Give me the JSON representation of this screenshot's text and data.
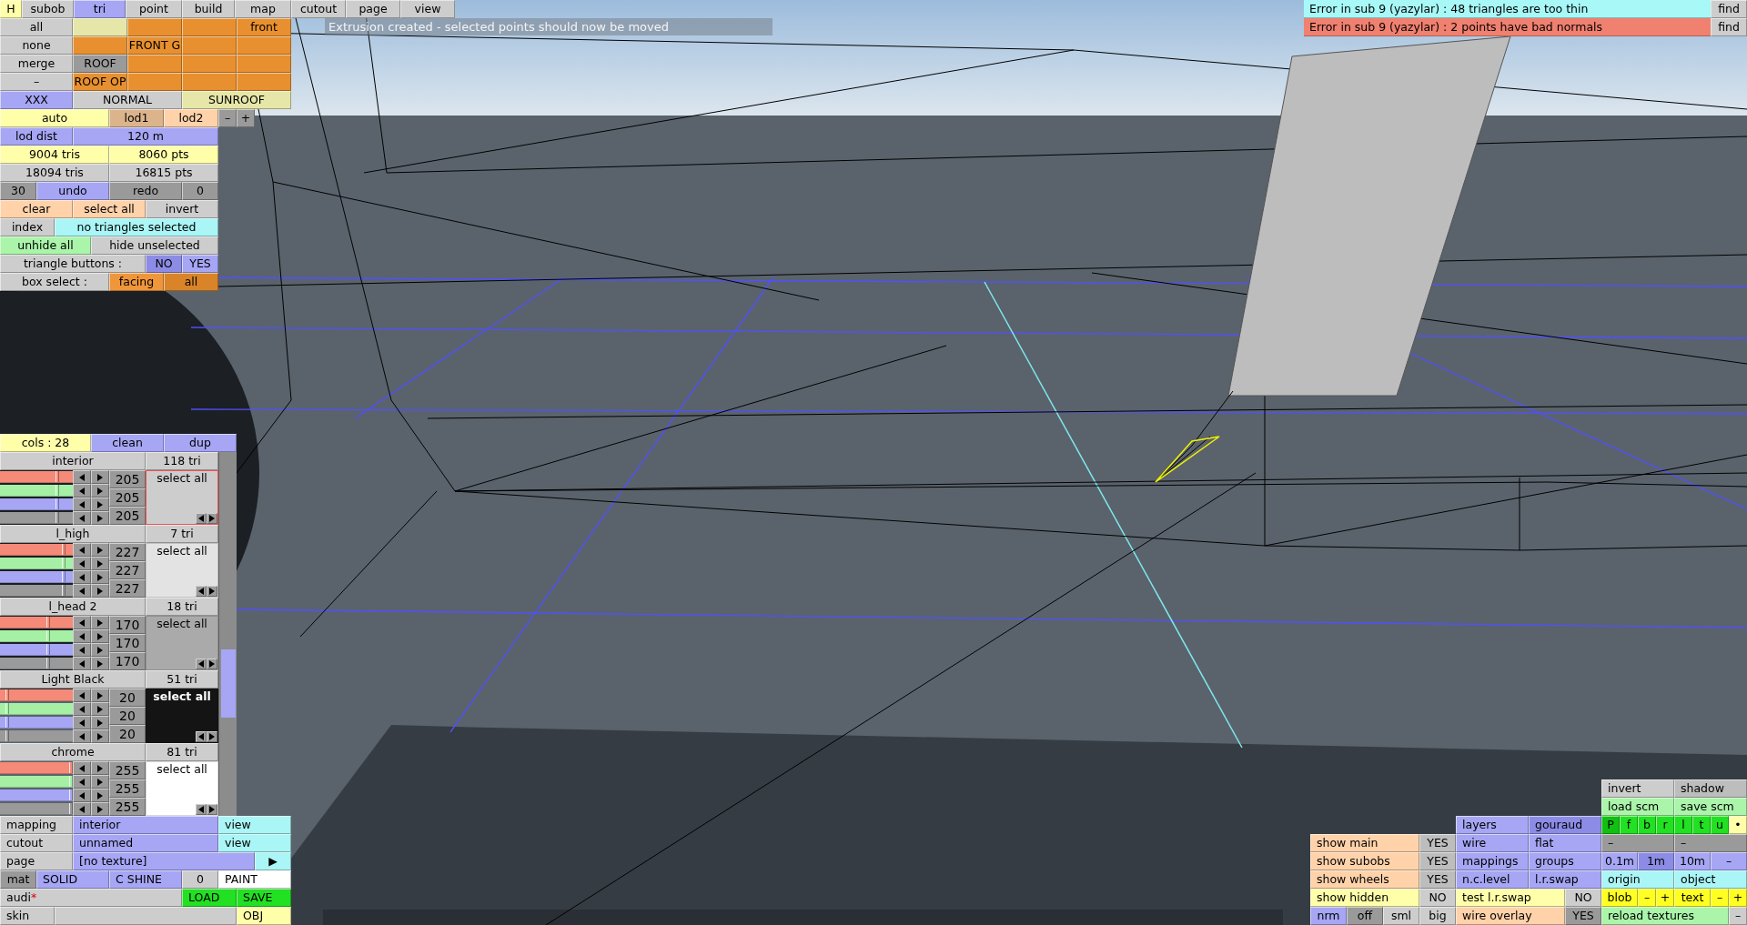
{
  "tabs": [
    {
      "label": "H",
      "kind": "toggle",
      "selected": false
    },
    {
      "label": "subob",
      "kind": "tab",
      "selected": false
    },
    {
      "label": "tri",
      "kind": "tab",
      "selected": true
    },
    {
      "label": "point",
      "kind": "tab",
      "selected": false
    },
    {
      "label": "build",
      "kind": "tab",
      "selected": false
    },
    {
      "label": "map",
      "kind": "tab",
      "selected": false
    },
    {
      "label": "cutout",
      "kind": "tab",
      "selected": false
    },
    {
      "label": "page",
      "kind": "tab",
      "selected": false
    },
    {
      "label": "view",
      "kind": "tab",
      "selected": false
    }
  ],
  "status_message": "Extrusion created - selected points should now be moved",
  "errors": [
    {
      "text": "Error in sub 9 (yazylar) : 48 triangles are too thin",
      "color": "#a8f8f8",
      "find": "find"
    },
    {
      "text": "Error in sub 9 (yazylar) : 2 points have bad normals",
      "color": "#f08070",
      "find": "find"
    }
  ],
  "top_panel": [
    [
      {
        "label": "all",
        "color": "#cdcdcd"
      },
      {
        "color": "#e6e6a8"
      },
      {
        "color": "#e8902f"
      },
      {
        "color": "#e8902f"
      },
      {
        "label": "front",
        "color": "#e8902f"
      }
    ],
    [
      {
        "label": "none",
        "color": "#cdcdcd"
      },
      {
        "color": "#e8902f"
      },
      {
        "label": "FRONT G",
        "color": "#e8902f"
      },
      {
        "color": "#e8902f"
      },
      {
        "color": "#e8902f"
      }
    ],
    [
      {
        "label": "merge",
        "color": "#cdcdcd"
      },
      {
        "label": "ROOF",
        "color": "#9a9a9a"
      },
      {
        "color": "#e8902f"
      },
      {
        "color": "#e8902f"
      },
      {
        "color": "#e8902f"
      }
    ],
    [
      {
        "label": "–",
        "color": "#cdcdcd"
      },
      {
        "label": "ROOF OP",
        "color": "#e8902f"
      },
      {
        "color": "#e8902f"
      },
      {
        "color": "#e8902f"
      },
      {
        "color": "#e8902f"
      }
    ],
    [
      {
        "label": "XXX",
        "color": "#a6a6f5"
      },
      {
        "label": "NORMAL",
        "color": "#cdcdcd"
      },
      {
        "label": "SUNROOF",
        "color": "#e6e6a8"
      }
    ],
    [
      {
        "label": "auto",
        "color": "#ffffaa"
      },
      {
        "label": "lod1",
        "color": "#dcb48c"
      },
      {
        "label": "lod2",
        "color": "#ffd2aa"
      },
      {
        "label": "–",
        "color": "#9a9a9a"
      },
      {
        "label": "+",
        "color": "#9a9a9a"
      }
    ],
    [
      {
        "label": "lod dist",
        "color": "#a6a6f5"
      },
      {
        "label": "120 m",
        "color": "#a6a6f5"
      }
    ],
    [
      {
        "label": "9004 tris",
        "color": "#ffffaa"
      },
      {
        "label": "8060 pts",
        "color": "#ffffaa"
      }
    ],
    [
      {
        "label": "18094 tris",
        "color": "#cdcdcd"
      },
      {
        "label": "16815 pts",
        "color": "#cdcdcd"
      }
    ],
    [
      {
        "label": "30",
        "color": "#9a9a9a"
      },
      {
        "label": "undo",
        "color": "#a6a6f5"
      },
      {
        "label": "redo",
        "color": "#9a9a9a"
      },
      {
        "label": "0",
        "color": "#9a9a9a"
      }
    ],
    [
      {
        "label": "clear",
        "color": "#ffd2aa"
      },
      {
        "label": "select all",
        "color": "#ffd2aa"
      },
      {
        "label": "invert",
        "color": "#cdcdcd"
      }
    ],
    [
      {
        "label": "index",
        "color": "#cdcdcd"
      },
      {
        "label": "no triangles selected",
        "color": "#aaf5f5"
      }
    ],
    [
      {
        "label": "unhide all",
        "color": "#aaf5aa"
      },
      {
        "label": "hide unselected",
        "color": "#cdcdcd"
      }
    ],
    [
      {
        "label": "triangle buttons :",
        "color": "#cdcdcd"
      },
      {
        "label": "NO",
        "color": "#8c8ce6"
      },
      {
        "label": "YES",
        "color": "#a6a6f5"
      }
    ],
    [
      {
        "label": "box select :",
        "color": "#cdcdcd"
      },
      {
        "label": "facing",
        "color": "#f0963a"
      },
      {
        "label": "all",
        "color": "#d98428"
      }
    ]
  ],
  "color_list": {
    "header": [
      {
        "label": "cols : 28",
        "color": "#ffffaa"
      },
      {
        "label": "clean",
        "color": "#a6a6f5"
      },
      {
        "label": "dup",
        "color": "#a6a6f5"
      }
    ],
    "materials": [
      {
        "name": "interior",
        "count": "118 tri",
        "color": "#cdcdcd",
        "selected": true,
        "select_label": "select all",
        "levels": [
          {
            "level": 0.804
          },
          {
            "level": 0.804
          },
          {
            "level": 0.804
          },
          {
            "level": 0.804
          }
        ],
        "values": [
          "205",
          "205",
          "205"
        ]
      },
      {
        "name": "l_high",
        "count": "7 tri",
        "color": "#e3e3e3",
        "selected": false,
        "select_label": "select all",
        "levels": [
          {
            "level": 0.89
          },
          {
            "level": 0.89
          },
          {
            "level": 0.89
          },
          {
            "level": 0.89
          }
        ],
        "values": [
          "227",
          "227",
          "227"
        ]
      },
      {
        "name": "l_head 2",
        "count": "18 tri",
        "color": "#aaaaaa",
        "selected": false,
        "select_label": "select all",
        "levels": [
          {
            "level": 0.667
          },
          {
            "level": 0.667
          },
          {
            "level": 0.667
          },
          {
            "level": 0.667
          }
        ],
        "values": [
          "170",
          "170",
          "170"
        ]
      },
      {
        "name": "Light Black",
        "count": "51 tri",
        "color": "#141414",
        "selected": false,
        "select_label": "select all",
        "levels": [
          {
            "level": 0.078
          },
          {
            "level": 0.078
          },
          {
            "level": 0.078
          },
          {
            "level": 0.078
          }
        ],
        "values": [
          "20",
          "20",
          "20"
        ]
      },
      {
        "name": "chrome",
        "count": "81 tri",
        "color": "#ffffff",
        "selected": false,
        "select_label": "select all",
        "levels": [
          {
            "level": 1
          },
          {
            "level": 1
          },
          {
            "level": 1
          },
          {
            "level": 1
          }
        ],
        "values": [
          "255",
          "255",
          "255"
        ]
      }
    ]
  },
  "bottom_left": [
    [
      {
        "label": "mapping",
        "color": "#cdcdcd"
      },
      {
        "label": "interior",
        "color": "#a6a6f5"
      },
      {
        "label": "view",
        "color": "#aaf5f5"
      }
    ],
    [
      {
        "label": "cutout",
        "color": "#cdcdcd"
      },
      {
        "label": "unnamed",
        "color": "#a6a6f5"
      },
      {
        "label": "view",
        "color": "#aaf5f5"
      }
    ],
    [
      {
        "label": "page",
        "color": "#cdcdcd"
      },
      {
        "label": "[no texture]",
        "color": "#a6a6f5"
      },
      {
        "label": "▶",
        "color": "#aaf5f5"
      }
    ],
    [
      {
        "label": "mat",
        "color": "#9a9a9a"
      },
      {
        "label": "SOLID",
        "color": "#a6a6f5"
      },
      {
        "label": "C SHINE",
        "color": "#a6a6f5"
      },
      {
        "label": "0",
        "color": "#cdcdcd"
      },
      {
        "label": "PAINT",
        "color": "#ffffff"
      }
    ],
    [
      {
        "label": "audi",
        "suffix": "*",
        "color": "#cdcdcd"
      },
      {
        "label": "LOAD",
        "color": "#22e022"
      },
      {
        "label": "SAVE",
        "color": "#22e022"
      }
    ],
    [
      {
        "label": "skin",
        "color": "#cdcdcd"
      },
      {
        "color": "#cdcdcd"
      },
      {
        "label": "OBJ",
        "color": "#ffffaa"
      }
    ]
  ],
  "bottom_right": [
    [
      {
        "label": "invert",
        "color": "#cdcdcd"
      },
      {
        "label": "shadow",
        "color": "#bdbdbd"
      }
    ],
    [
      {
        "label": "load scm",
        "color": "#aaf5aa"
      },
      {
        "label": "save scm",
        "color": "#aaf5aa"
      }
    ],
    [
      {
        "label": "layers",
        "color": "#a6a6f5"
      },
      {
        "label": "gouraud",
        "color": "#8c8ce6"
      },
      {
        "label": "P",
        "color": "#11c011"
      },
      {
        "label": "f",
        "color": "#22e022"
      },
      {
        "label": "b",
        "color": "#22e022"
      },
      {
        "label": "r",
        "color": "#22e022"
      },
      {
        "label": "l",
        "color": "#22e022"
      },
      {
        "label": "t",
        "color": "#22e022"
      },
      {
        "label": "u",
        "color": "#22e022"
      },
      {
        "label": "•",
        "color": "#ffffaa"
      }
    ],
    [
      {
        "label": "show main",
        "color": "#ffd2aa"
      },
      {
        "label": "YES",
        "color": "#bdbdbd"
      },
      {
        "label": "wire",
        "color": "#a6a6f5"
      },
      {
        "label": "flat",
        "color": "#a6a6f5"
      },
      {
        "label": "–",
        "color": "#9a9a9a"
      },
      {
        "label": "–",
        "color": "#9a9a9a"
      }
    ],
    [
      {
        "label": "show subobs",
        "color": "#ffd2aa"
      },
      {
        "label": "YES",
        "color": "#bdbdbd"
      },
      {
        "label": "mappings",
        "color": "#a6a6f5"
      },
      {
        "label": "groups",
        "color": "#a6a6f5"
      },
      {
        "label": "0.1m",
        "color": "#a6a6f5"
      },
      {
        "label": "1m",
        "color": "#8c8ce6"
      },
      {
        "label": "10m",
        "color": "#a6a6f5"
      },
      {
        "label": "–",
        "color": "#a6a6f5"
      }
    ],
    [
      {
        "label": "show wheels",
        "color": "#ffd2aa"
      },
      {
        "label": "YES",
        "color": "#bdbdbd"
      },
      {
        "label": "n.c.level",
        "color": "#a6a6f5"
      },
      {
        "label": "l.r.swap",
        "color": "#a6a6f5"
      },
      {
        "label": "origin",
        "color": "#aaf5f5"
      },
      {
        "label": "object",
        "color": "#aaf5f5"
      }
    ],
    [
      {
        "label": "show hidden",
        "color": "#ffffaa"
      },
      {
        "label": "NO",
        "color": "#cdcdcd"
      },
      {
        "label": "test l.r.swap",
        "color": "#ffffaa"
      },
      {
        "label": "NO",
        "color": "#cdcdcd"
      },
      {
        "label": "blob",
        "color": "#ffff22"
      },
      {
        "label": "–",
        "color": "#ffff22"
      },
      {
        "label": "+",
        "color": "#ffff22"
      },
      {
        "label": "text",
        "color": "#ffff22"
      },
      {
        "label": "–",
        "color": "#ffff22"
      },
      {
        "label": "+",
        "color": "#ffff22"
      }
    ],
    [
      {
        "label": "nrm",
        "color": "#a6a6f5"
      },
      {
        "label": "off",
        "color": "#9a9a9a"
      },
      {
        "label": "sml",
        "color": "#cdcdcd"
      },
      {
        "label": "big",
        "color": "#cdcdcd"
      },
      {
        "label": "wire overlay",
        "color": "#ffd2aa"
      },
      {
        "label": "YES",
        "color": "#9a9a9a"
      },
      {
        "label": "reload textures",
        "color": "#aaf5aa"
      },
      {
        "label": "–",
        "color": "#cdcdcd"
      }
    ]
  ]
}
